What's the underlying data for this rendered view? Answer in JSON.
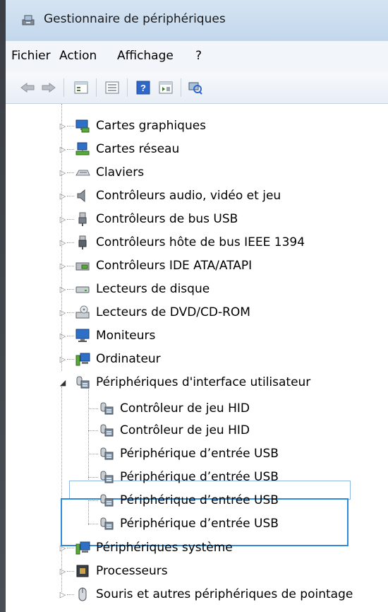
{
  "window": {
    "title": "Gestionnaire de périphériques",
    "title_icon": "device-manager-icon"
  },
  "menu": {
    "items": [
      "Fichier",
      "Action",
      "Affichage",
      "?"
    ]
  },
  "toolbar": {
    "buttons": [
      "back-arrow-icon",
      "forward-arrow-icon",
      "properties-view-icon",
      "show-hide-console-tree-icon",
      "help-icon",
      "action-pane-icon",
      "scan-hardware-icon"
    ]
  },
  "tree": {
    "categories": [
      {
        "label": "Cartes graphiques",
        "icon": "display-adapter-icon",
        "expanded": false
      },
      {
        "label": "Cartes réseau",
        "icon": "network-adapter-icon",
        "expanded": false
      },
      {
        "label": "Claviers",
        "icon": "keyboard-icon",
        "expanded": false
      },
      {
        "label": "Contrôleurs audio, vidéo et jeu",
        "icon": "speaker-icon",
        "expanded": false
      },
      {
        "label": "Contrôleurs de bus USB",
        "icon": "usb-connector-icon",
        "expanded": false
      },
      {
        "label": "Contrôleurs hôte de bus IEEE 1394",
        "icon": "firewire-connector-icon",
        "expanded": false
      },
      {
        "label": "Contrôleurs IDE ATA/ATAPI",
        "icon": "ide-controller-icon",
        "expanded": false
      },
      {
        "label": "Lecteurs de disque",
        "icon": "disk-drive-icon",
        "expanded": false
      },
      {
        "label": "Lecteurs de DVD/CD-ROM",
        "icon": "dvd-drive-icon",
        "expanded": false
      },
      {
        "label": "Moniteurs",
        "icon": "monitor-icon",
        "expanded": false
      },
      {
        "label": "Ordinateur",
        "icon": "computer-icon",
        "expanded": false
      },
      {
        "label": "Périphériques d'interface utilisateur",
        "icon": "hid-device-icon",
        "expanded": true,
        "children": [
          "Contrôleur de jeu HID",
          "Contrôleur de jeu HID",
          "Périphérique d’entrée USB",
          "Périphérique d’entrée USB",
          "Périphérique d’entrée USB",
          "Périphérique d’entrée USB"
        ]
      },
      {
        "label": "Périphériques système",
        "icon": "system-device-icon",
        "expanded": false
      },
      {
        "label": "Processeurs",
        "icon": "processor-icon",
        "expanded": false
      },
      {
        "label": "Souris et autres périphériques de pointage",
        "icon": "mouse-icon",
        "expanded": false
      }
    ]
  },
  "colors": {
    "titlebar": "#c9dcef",
    "highlight_box": "#2e8bd9",
    "focus_border": "#8fb6e4",
    "menu_bg": "#f2f5f9"
  }
}
